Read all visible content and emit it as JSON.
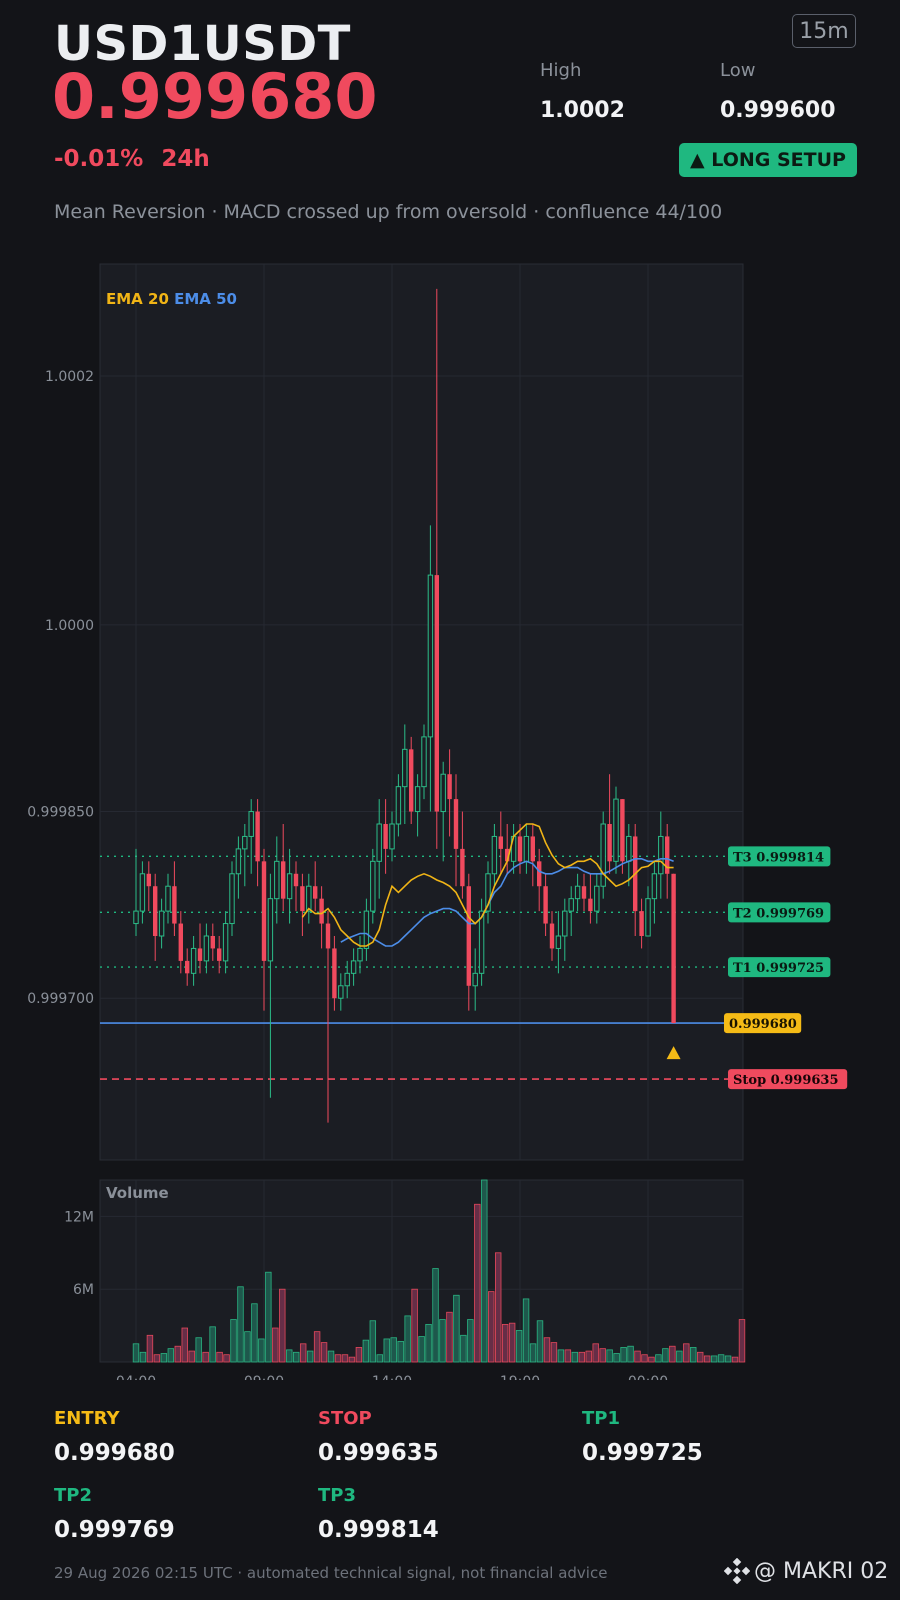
{
  "header": {
    "symbol": "USD1USDT",
    "price": "0.999680",
    "change": "-0.01%",
    "change_period": "24h",
    "timeframe": "15m",
    "high_label": "High",
    "high_value": "1.0002",
    "low_label": "Low",
    "low_value": "0.999600",
    "setup_label": "▲ LONG SETUP",
    "description": "Mean Reversion · MACD crossed up from oversold · confluence 44/100"
  },
  "colors": {
    "up": "#2bbd88",
    "down": "#f04a5e",
    "ema20": "#f0b416",
    "ema50": "#4c8de8",
    "entry": "#f5bb16",
    "stop": "#f04a5e",
    "target": "#1fb880",
    "background": "#131418",
    "panel": "#1b1d23"
  },
  "chart_data": [
    {
      "type": "candlestick",
      "legend": [
        "EMA 20",
        "EMA 50"
      ],
      "y_ticks": [
        "0.999700",
        "0.999850",
        "1.0000",
        "1.0002"
      ],
      "y_tick_values": [
        0.9997,
        0.99985,
        1.0,
        1.0002
      ],
      "ylim": [
        0.99957,
        1.00029
      ],
      "x_ticks": [
        "04:00",
        "09:00",
        "14:00",
        "19:00",
        "00:00"
      ],
      "x_tick_index": [
        0,
        20,
        40,
        60,
        80
      ],
      "candles": [
        [
          0.99976,
          0.99982,
          0.99975,
          0.99977
        ],
        [
          0.99977,
          0.99981,
          0.99976,
          0.9998
        ],
        [
          0.9998,
          0.99981,
          0.99977,
          0.99979
        ],
        [
          0.99979,
          0.9998,
          0.99973,
          0.99975
        ],
        [
          0.99975,
          0.99978,
          0.99974,
          0.99977
        ],
        [
          0.99977,
          0.9998,
          0.99976,
          0.99979
        ],
        [
          0.99979,
          0.99981,
          0.99975,
          0.99976
        ],
        [
          0.99976,
          0.99977,
          0.99972,
          0.99973
        ],
        [
          0.99973,
          0.99974,
          0.99971,
          0.99972
        ],
        [
          0.99972,
          0.99975,
          0.99971,
          0.99974
        ],
        [
          0.99974,
          0.99976,
          0.99972,
          0.99973
        ],
        [
          0.99973,
          0.99976,
          0.99972,
          0.99975
        ],
        [
          0.99975,
          0.99976,
          0.99973,
          0.99974
        ],
        [
          0.99974,
          0.99975,
          0.99972,
          0.99973
        ],
        [
          0.99973,
          0.99977,
          0.99972,
          0.99976
        ],
        [
          0.99976,
          0.99981,
          0.99975,
          0.9998
        ],
        [
          0.9998,
          0.99983,
          0.99978,
          0.99982
        ],
        [
          0.99982,
          0.99984,
          0.99979,
          0.99983
        ],
        [
          0.99983,
          0.99986,
          0.9998,
          0.99985
        ],
        [
          0.99985,
          0.99986,
          0.99979,
          0.99981
        ],
        [
          0.99981,
          0.99982,
          0.99969,
          0.99973
        ],
        [
          0.99973,
          0.9998,
          0.99962,
          0.99978
        ],
        [
          0.99978,
          0.99983,
          0.99976,
          0.99981
        ],
        [
          0.99981,
          0.99984,
          0.99977,
          0.99978
        ],
        [
          0.99978,
          0.99982,
          0.99976,
          0.9998
        ],
        [
          0.9998,
          0.99981,
          0.99977,
          0.99979
        ],
        [
          0.99979,
          0.9998,
          0.99975,
          0.99977
        ],
        [
          0.99977,
          0.9998,
          0.99976,
          0.99979
        ],
        [
          0.99979,
          0.99981,
          0.99977,
          0.99978
        ],
        [
          0.99978,
          0.99979,
          0.99974,
          0.99976
        ],
        [
          0.99976,
          0.99977,
          0.9996,
          0.99974
        ],
        [
          0.99974,
          0.99975,
          0.99969,
          0.9997
        ],
        [
          0.9997,
          0.99972,
          0.99969,
          0.99971
        ],
        [
          0.99971,
          0.99973,
          0.9997,
          0.99972
        ],
        [
          0.99972,
          0.99974,
          0.99971,
          0.99973
        ],
        [
          0.99973,
          0.99975,
          0.99972,
          0.99974
        ],
        [
          0.99974,
          0.99978,
          0.99973,
          0.99977
        ],
        [
          0.99977,
          0.99982,
          0.99976,
          0.99981
        ],
        [
          0.99981,
          0.99986,
          0.99978,
          0.99984
        ],
        [
          0.99984,
          0.99986,
          0.9998,
          0.99982
        ],
        [
          0.99982,
          0.99985,
          0.99981,
          0.99984
        ],
        [
          0.99984,
          0.99988,
          0.99983,
          0.99987
        ],
        [
          0.99987,
          0.99992,
          0.99984,
          0.9999
        ],
        [
          0.9999,
          0.99991,
          0.99984,
          0.99985
        ],
        [
          0.99985,
          0.99988,
          0.99983,
          0.99987
        ],
        [
          0.99987,
          0.99992,
          0.99986,
          0.99991
        ],
        [
          0.99991,
          1.00008,
          0.99985,
          1.00004
        ],
        [
          1.00004,
          1.00027,
          0.99982,
          0.99985
        ],
        [
          0.99985,
          0.99989,
          0.99981,
          0.99988
        ],
        [
          0.99988,
          0.9999,
          0.99983,
          0.99986
        ],
        [
          0.99986,
          0.99988,
          0.99979,
          0.99982
        ],
        [
          0.99982,
          0.99985,
          0.99978,
          0.99979
        ],
        [
          0.99979,
          0.9998,
          0.99969,
          0.99971
        ],
        [
          0.99971,
          0.99974,
          0.99969,
          0.99972
        ],
        [
          0.99972,
          0.99978,
          0.99971,
          0.99977
        ],
        [
          0.99977,
          0.99981,
          0.99976,
          0.9998
        ],
        [
          0.9998,
          0.99984,
          0.99979,
          0.99983
        ],
        [
          0.99983,
          0.99985,
          0.9998,
          0.99982
        ],
        [
          0.99982,
          0.99984,
          0.9998,
          0.99981
        ],
        [
          0.99981,
          0.99984,
          0.9998,
          0.99983
        ],
        [
          0.99983,
          0.99984,
          0.9998,
          0.99981
        ],
        [
          0.99981,
          0.99984,
          0.9998,
          0.99983
        ],
        [
          0.99983,
          0.99984,
          0.99979,
          0.99981
        ],
        [
          0.99981,
          0.99982,
          0.99977,
          0.99979
        ],
        [
          0.99979,
          0.9998,
          0.99975,
          0.99976
        ],
        [
          0.99976,
          0.99977,
          0.99973,
          0.99974
        ],
        [
          0.99974,
          0.99977,
          0.99972,
          0.99975
        ],
        [
          0.99975,
          0.99978,
          0.99973,
          0.99977
        ],
        [
          0.99977,
          0.99979,
          0.99975,
          0.99978
        ],
        [
          0.99978,
          0.9998,
          0.99977,
          0.99979
        ],
        [
          0.99979,
          0.9998,
          0.99977,
          0.99978
        ],
        [
          0.99978,
          0.9998,
          0.99976,
          0.99977
        ],
        [
          0.99977,
          0.9998,
          0.99976,
          0.99979
        ],
        [
          0.99979,
          0.99985,
          0.99978,
          0.99984
        ],
        [
          0.99984,
          0.99988,
          0.9998,
          0.99981
        ],
        [
          0.99981,
          0.99987,
          0.9998,
          0.99986
        ],
        [
          0.99986,
          0.99986,
          0.9998,
          0.99981
        ],
        [
          0.99981,
          0.99984,
          0.99979,
          0.99983
        ],
        [
          0.99983,
          0.99984,
          0.99975,
          0.99977
        ],
        [
          0.99977,
          0.99978,
          0.99974,
          0.99975
        ],
        [
          0.99975,
          0.99979,
          0.99975,
          0.99978
        ],
        [
          0.99978,
          0.99981,
          0.99976,
          0.9998
        ],
        [
          0.9998,
          0.99985,
          0.99978,
          0.99983
        ],
        [
          0.99983,
          0.99984,
          0.99978,
          0.9998
        ],
        [
          0.9998,
          0.9998,
          0.99968,
          0.99968
        ]
      ],
      "ema20": [
        0.999765,
        0.999772,
        0.999768,
        0.999768,
        0.999772,
        0.999765,
        0.999755,
        0.99975,
        0.999745,
        0.999742,
        0.999742,
        0.999745,
        0.999755,
        0.999775,
        0.99979,
        0.999785,
        0.99979,
        0.999795,
        0.999798,
        0.9998,
        0.999798,
        0.999795,
        0.999793,
        0.99979,
        0.999785,
        0.999775,
        0.999765,
        0.99976,
        0.999765,
        0.999775,
        0.99979,
        0.9998,
        0.99981,
        0.99983,
        0.999835,
        0.99984,
        0.99984,
        0.999838,
        0.999825,
        0.999815,
        0.999808,
        0.999805,
        0.999807,
        0.99981,
        0.99981,
        0.999812,
        0.999808,
        0.9998,
        0.999795,
        0.99979,
        0.999792,
        0.999795,
        0.9998,
        0.999805,
        0.999806,
        0.99981,
        0.99981,
        0.999805,
        0.999805
      ],
      "ema50": [
        0.999745,
        0.999748,
        0.99975,
        0.999752,
        0.999752,
        0.999748,
        0.999745,
        0.999742,
        0.999742,
        0.999745,
        0.99975,
        0.999755,
        0.99976,
        0.999765,
        0.999768,
        0.99977,
        0.999772,
        0.999772,
        0.99977,
        0.999765,
        0.99976,
        0.99976,
        0.999765,
        0.999775,
        0.999785,
        0.99979,
        0.9998,
        0.999805,
        0.999808,
        0.99981,
        0.999808,
        0.999802,
        0.9998,
        0.9998,
        0.999802,
        0.999805,
        0.999805,
        0.999805,
        0.999802,
        0.9998,
        0.9998,
        0.9998,
        0.999802,
        0.999805,
        0.999808,
        0.99981,
        0.999812,
        0.999812,
        0.99981,
        0.99981,
        0.999812,
        0.999812,
        0.99981
      ],
      "levels": [
        {
          "label": "T3 0.999814",
          "value": 0.999814,
          "style": "target"
        },
        {
          "label": "T2 0.999769",
          "value": 0.999769,
          "style": "target"
        },
        {
          "label": "T1 0.999725",
          "value": 0.999725,
          "style": "target"
        },
        {
          "label": "0.999680",
          "value": 0.99968,
          "style": "entry"
        },
        {
          "label": "Stop 0.999635",
          "value": 0.999635,
          "style": "stop"
        }
      ]
    },
    {
      "type": "bar",
      "title": "Volume",
      "y_ticks": [
        "6M",
        "12M"
      ],
      "y_tick_values": [
        6,
        12
      ],
      "ylim": [
        0,
        15
      ],
      "unit": "M",
      "values": [
        1.5,
        0.8,
        2.2,
        0.6,
        0.7,
        1.1,
        1.3,
        2.8,
        0.9,
        2.0,
        0.8,
        2.9,
        0.8,
        0.6,
        3.5,
        6.2,
        2.5,
        4.8,
        1.9,
        7.4,
        2.8,
        6.0,
        1.0,
        0.8,
        1.5,
        0.9,
        2.5,
        1.6,
        0.9,
        0.6,
        0.6,
        0.4,
        1.2,
        1.8,
        3.4,
        0.6,
        1.9,
        2.0,
        1.7,
        3.8,
        6.0,
        2.1,
        3.1,
        7.7,
        3.5,
        4.1,
        5.5,
        2.2,
        3.5,
        13.0,
        15.0,
        5.8,
        9.0,
        3.1,
        3.2,
        2.6,
        5.2,
        1.5,
        3.4,
        2.0,
        1.6,
        1.0,
        1.0,
        0.8,
        0.8,
        0.9,
        1.5,
        1.1,
        1.0,
        0.7,
        1.2,
        1.3,
        0.9,
        0.6,
        0.4,
        0.6,
        1.1,
        1.3,
        0.9,
        1.5,
        1.2,
        0.8,
        0.5,
        0.5,
        0.6,
        0.5,
        0.4,
        3.5
      ]
    }
  ],
  "levels_panel": [
    {
      "label": "ENTRY",
      "value": "0.999680",
      "color": "#f5bb16"
    },
    {
      "label": "STOP",
      "value": "0.999635",
      "color": "#f04a5e"
    },
    {
      "label": "TP1",
      "value": "0.999725",
      "color": "#1fb880"
    },
    {
      "label": "TP2",
      "value": "0.999769",
      "color": "#1fb880"
    },
    {
      "label": "TP3",
      "value": "0.999814",
      "color": "#1fb880"
    }
  ],
  "footer": {
    "text": "29 Aug 2026 02:15 UTC  ·  automated technical signal, not financial advice",
    "brand": "@ MAKRI 02",
    "brand_icon": "binance-diamond-icon"
  }
}
